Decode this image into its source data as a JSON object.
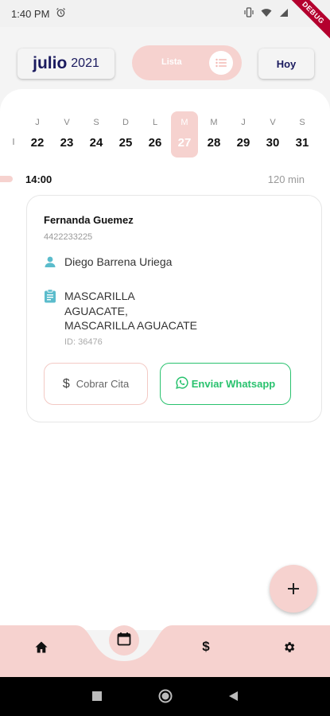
{
  "status_bar": {
    "time": "1:40 PM",
    "debug_label": "DEBUG"
  },
  "header": {
    "month": "julio",
    "year": "2021",
    "view_label": "Lista",
    "today_label": "Hoy"
  },
  "week": [
    {
      "name": "J",
      "num": "22",
      "selected": false
    },
    {
      "name": "V",
      "num": "23",
      "selected": false
    },
    {
      "name": "S",
      "num": "24",
      "selected": false
    },
    {
      "name": "D",
      "num": "25",
      "selected": false
    },
    {
      "name": "L",
      "num": "26",
      "selected": false
    },
    {
      "name": "M",
      "num": "27",
      "selected": true
    },
    {
      "name": "M",
      "num": "28",
      "selected": false
    },
    {
      "name": "J",
      "num": "29",
      "selected": false
    },
    {
      "name": "V",
      "num": "30",
      "selected": false
    },
    {
      "name": "S",
      "num": "31",
      "selected": false
    }
  ],
  "appointment": {
    "time": "14:00",
    "duration": "120 min",
    "client_name": "Fernanda Guemez",
    "client_phone": "4422233225",
    "employee": "Diego Barrena Uriega",
    "services": [
      "MASCARILLA",
      "AGUACATE,",
      "MASCARILLA AGUACATE"
    ],
    "id_text": "ID: 36476",
    "charge_label": "Cobrar Cita",
    "whatsapp_label": "Enviar Whatsapp"
  },
  "fab": {
    "icon": "plus-icon"
  },
  "colors": {
    "accent": "#f6d2cf",
    "navy": "#1a1a5e",
    "whatsapp": "#29c26e"
  },
  "nav": {
    "items": [
      "home-icon",
      "calendar-icon",
      "dollar-icon",
      "gear-icon"
    ]
  }
}
